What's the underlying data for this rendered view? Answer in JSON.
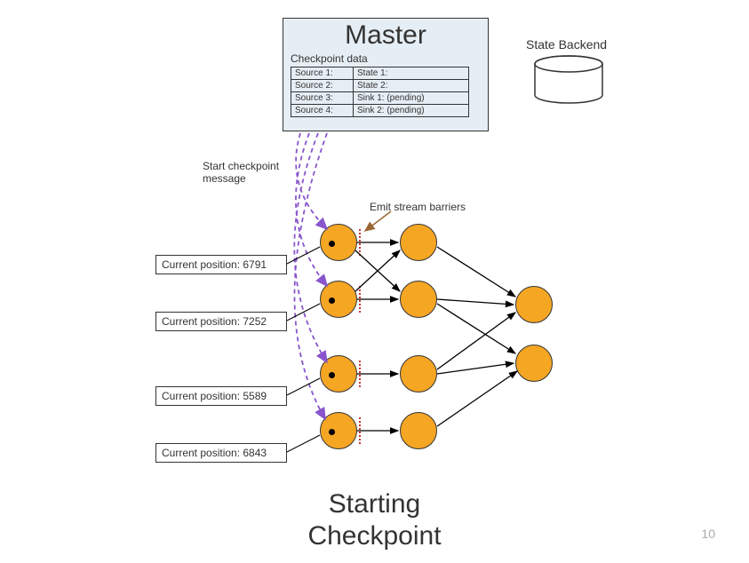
{
  "master": {
    "title": "Master",
    "checkpoint_label": "Checkpoint data",
    "table": [
      [
        "Source 1:",
        "State 1:"
      ],
      [
        "Source 2:",
        "State 2:"
      ],
      [
        "Source 3:",
        "Sink 1: (pending)"
      ],
      [
        "Source 4:",
        "Sink 2: (pending)"
      ]
    ]
  },
  "state_backend_label": "State Backend",
  "labels": {
    "start_checkpoint": "Start checkpoint\nmessage",
    "emit_barriers": "Emit stream barriers"
  },
  "positions": [
    {
      "label": "Current position: 6791"
    },
    {
      "label": "Current position: 7252"
    },
    {
      "label": "Current position: 5589"
    },
    {
      "label": "Current position: 6843"
    }
  ],
  "page_title": "Starting\nCheckpoint",
  "page_number": "10",
  "colors": {
    "node_fill": "#f5a623",
    "master_bg": "#e6eef5",
    "arrow_purple": "#8855cc",
    "arrow_brown": "#996633",
    "barrier_red": "#cc3333"
  }
}
